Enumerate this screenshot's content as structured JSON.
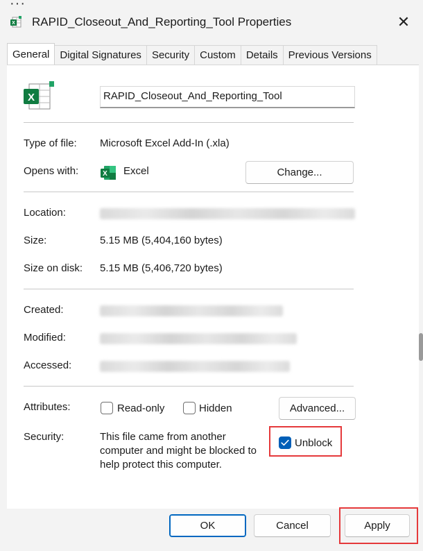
{
  "window": {
    "title": "RAPID_Closeout_And_Reporting_Tool Properties",
    "close_glyph": "✕"
  },
  "tabs": [
    {
      "label": "General",
      "active": true
    },
    {
      "label": "Digital Signatures"
    },
    {
      "label": "Security"
    },
    {
      "label": "Custom"
    },
    {
      "label": "Details"
    },
    {
      "label": "Previous Versions"
    }
  ],
  "general": {
    "filename": "RAPID_Closeout_And_Reporting_Tool",
    "type_label": "Type of file:",
    "type_value": "Microsoft Excel Add-In (.xla)",
    "opens_label": "Opens with:",
    "opens_value": "Excel",
    "change_button": "Change...",
    "location_label": "Location:",
    "size_label": "Size:",
    "size_value": "5.15 MB (5,404,160 bytes)",
    "size_disk_label": "Size on disk:",
    "size_disk_value": "5.15 MB (5,406,720 bytes)",
    "created_label": "Created:",
    "modified_label": "Modified:",
    "accessed_label": "Accessed:",
    "attributes_label": "Attributes:",
    "readonly_label": "Read-only",
    "readonly_checked": false,
    "hidden_label": "Hidden",
    "hidden_checked": false,
    "advanced_button": "Advanced...",
    "security_label": "Security:",
    "security_line1": "This file came from another",
    "security_line2": "computer and might be blocked to",
    "security_line3": "help protect this computer.",
    "unblock_label": "Unblock",
    "unblock_checked": true
  },
  "footer": {
    "ok": "OK",
    "cancel": "Cancel",
    "apply": "Apply"
  },
  "colors": {
    "excel_green": "#107c41",
    "accent_blue": "#005fb8",
    "highlight_red": "#e5393b"
  },
  "icons": [
    "excel-file-icon",
    "excel-app-icon",
    "close-icon",
    "checkmark-icon"
  ]
}
